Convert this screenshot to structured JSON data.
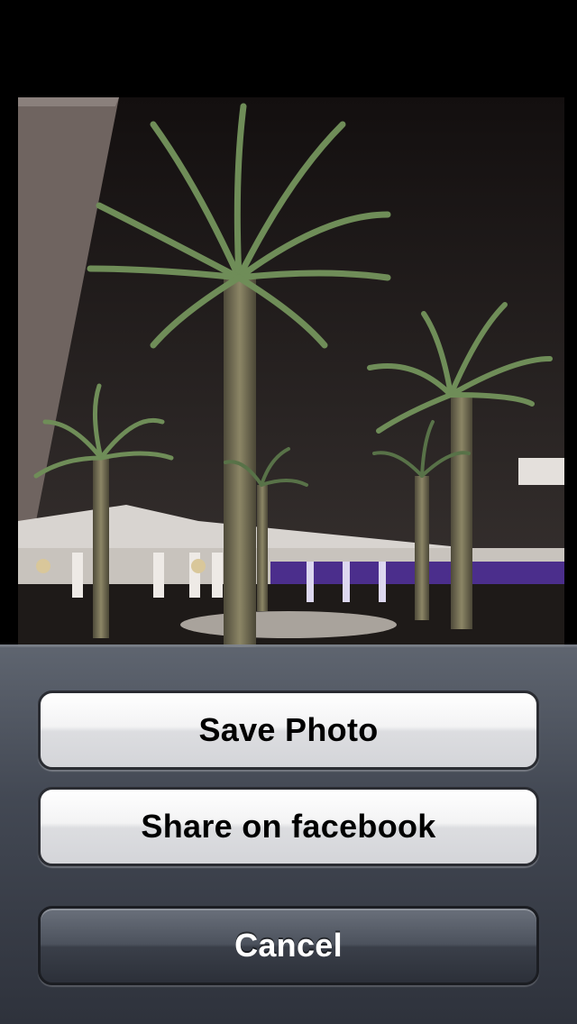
{
  "photo": {
    "description_icon": "night-palm-trees-photo"
  },
  "action_sheet": {
    "save_label": "Save Photo",
    "share_label": "Share on facebook",
    "cancel_label": "Cancel"
  },
  "colors": {
    "sheet_top": "#69707c",
    "sheet_bottom": "#30343e",
    "light_button": "#f3f3f4",
    "dark_button": "#4c525d"
  }
}
